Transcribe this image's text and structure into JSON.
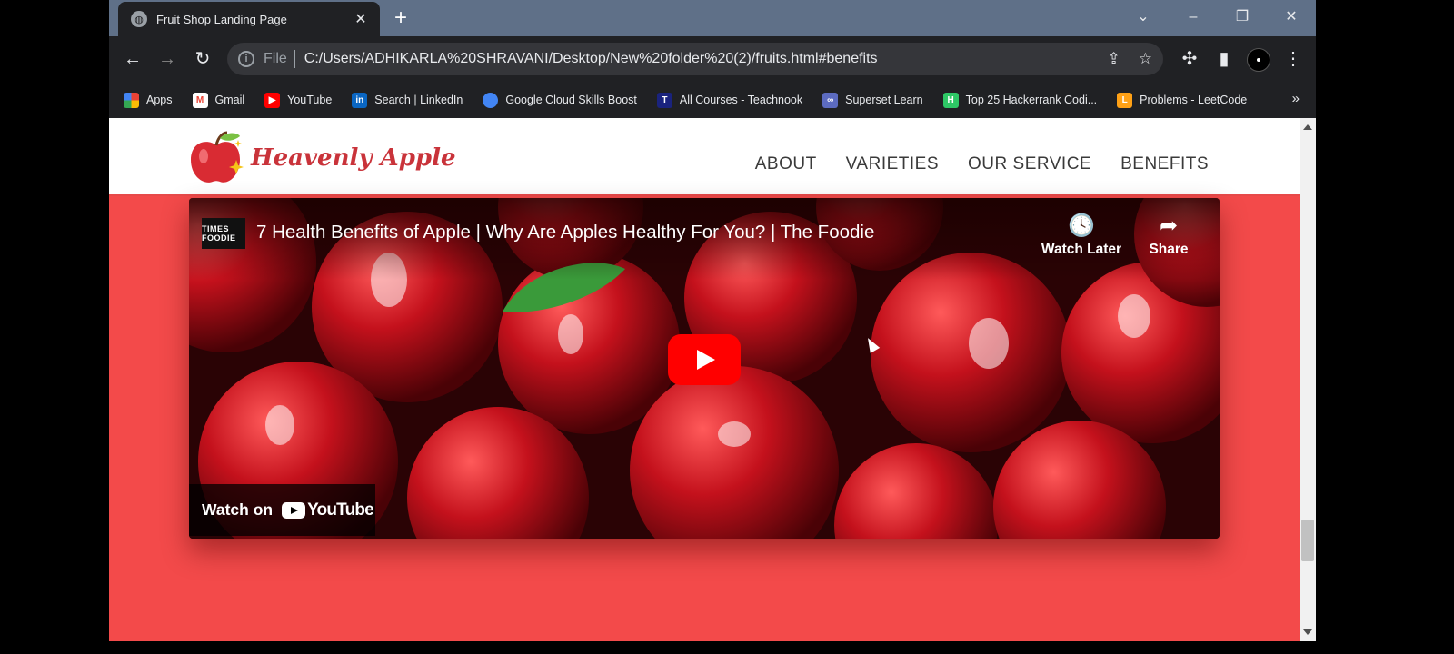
{
  "browser": {
    "tab": {
      "title": "Fruit Shop Landing Page",
      "favicon": "globe-icon"
    },
    "omnibox": {
      "scheme": "File",
      "url": "C:/Users/ADHIKARLA%20SHRAVANI/Desktop/New%20folder%20(2)/fruits.html#benefits"
    },
    "bookmarks": [
      {
        "label": "Apps",
        "icon": "apps-grid-icon",
        "color": "#ea4335"
      },
      {
        "label": "Gmail",
        "icon": "gmail-icon",
        "color": "#ea4335"
      },
      {
        "label": "YouTube",
        "icon": "youtube-icon",
        "color": "#ff0000"
      },
      {
        "label": "Search | LinkedIn",
        "icon": "linkedin-icon",
        "color": "#0a66c2"
      },
      {
        "label": "Google Cloud Skills Boost",
        "icon": "google-cloud-icon",
        "color": "#4285f4"
      },
      {
        "label": "All Courses - Teachnook",
        "icon": "teachnook-icon",
        "color": "#1a237e"
      },
      {
        "label": "Superset Learn",
        "icon": "superset-icon",
        "color": "#5c6bc0"
      },
      {
        "label": "Top 25 Hackerrank Codi...",
        "icon": "hackerrank-icon",
        "color": "#2ec866"
      },
      {
        "label": "Problems - LeetCode",
        "icon": "leetcode-icon",
        "color": "#ffa116"
      }
    ]
  },
  "site": {
    "logo_text": "Heavenly Apple",
    "nav": [
      "ABOUT",
      "VARIETIES",
      "OUR SERVICE",
      "BENEFITS"
    ],
    "accent_color": "#f34a4a"
  },
  "video": {
    "channel": "TIMES FOODIE",
    "title": "7 Health Benefits of Apple | Why Are Apples Healthy For You? | The Foodie",
    "watch_later": "Watch Later",
    "share": "Share",
    "watch_on": "Watch on",
    "youtube": "YouTube"
  }
}
